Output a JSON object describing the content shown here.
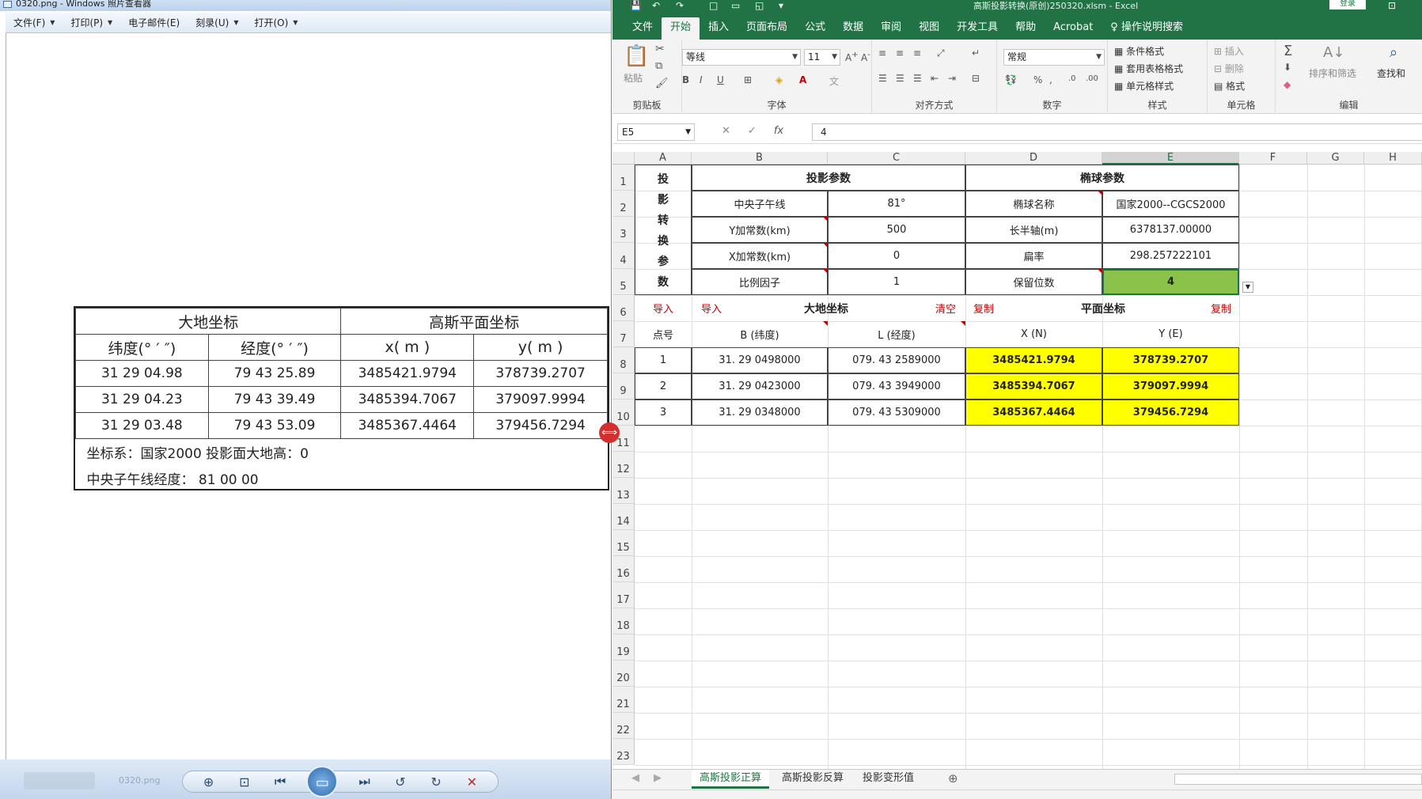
{
  "viewer": {
    "title": "0320.png - Windows 照片查看器",
    "menu": [
      "文件(F)",
      "打印(P)",
      "电子邮件(E)",
      "刻录(U)",
      "打开(O)"
    ],
    "photo_table": {
      "group_headers": [
        "大地坐标",
        "高斯平面坐标"
      ],
      "col_headers": [
        "纬度(° ′ ″)",
        "经度(° ′ ″)",
        "x( m )",
        "y( m )"
      ],
      "rows": [
        [
          "31 29 04.98",
          "79 43 25.89",
          "3485421.9794",
          "378739.2707"
        ],
        [
          "31 29 04.23",
          "79 43 39.49",
          "3485394.7067",
          "379097.9994"
        ],
        [
          "31 29 03.48",
          "79 43 53.09",
          "3485367.4464",
          "379456.7294"
        ]
      ],
      "note1": "坐标系：国家2000    投影面大地高：0",
      "note2": "中央子午线经度：  81 00 00"
    },
    "bottom_label": "0320.png"
  },
  "excel": {
    "title": "高斯投影转换(原创)250320.xlsm  -  Excel",
    "login_label": "登录",
    "ribbon_tabs": [
      "文件",
      "开始",
      "插入",
      "页面布局",
      "公式",
      "数据",
      "审阅",
      "视图",
      "开发工具",
      "帮助",
      "Acrobat"
    ],
    "tell_me": "操作说明搜索",
    "ribbon": {
      "clipboard": {
        "paste": "粘贴",
        "label": "剪贴板"
      },
      "font": {
        "name": "等线",
        "size": "11",
        "label": "字体"
      },
      "align": {
        "label": "对齐方式"
      },
      "number": {
        "format": "常规",
        "label": "数字"
      },
      "styles": {
        "cond": "条件格式",
        "table": "套用表格格式",
        "cell": "单元格样式",
        "label": "样式"
      },
      "cells": {
        "insert": "插入",
        "delete": "删除",
        "format": "格式",
        "label": "单元格"
      },
      "edit": {
        "sort": "排序和筛选",
        "find": "查找和",
        "label": "编辑"
      }
    },
    "name_box": "E5",
    "formula": "4",
    "columns": [
      "A",
      "B",
      "C",
      "D",
      "E",
      "F",
      "G",
      "H"
    ],
    "rows": [
      "1",
      "2",
      "3",
      "4",
      "5",
      "6",
      "7",
      "8",
      "9",
      "10",
      "11",
      "12",
      "13",
      "14",
      "15",
      "16",
      "17",
      "18",
      "19",
      "20",
      "21",
      "22",
      "23"
    ],
    "sheet": {
      "a_vertical": [
        "投",
        "影",
        "转",
        "换",
        "参",
        "数"
      ],
      "proj_header": "投影参数",
      "ellip_header": "椭球参数",
      "params": [
        {
          "k": "中央子午线",
          "v": "81°",
          "k2": "椭球名称",
          "v2": "国家2000--CGCS2000"
        },
        {
          "k": "Y加常数(km)",
          "v": "500",
          "k2": "长半轴(m)",
          "v2": "6378137.00000"
        },
        {
          "k": "X加常数(km)",
          "v": "0",
          "k2": "扁率",
          "v2": "298.257222101"
        },
        {
          "k": "比例因子",
          "v": "1",
          "k2": "保留位数",
          "v2": "4"
        }
      ],
      "row6": {
        "a": "导入",
        "b": "导入",
        "geo": "大地坐标",
        "clear": "清空",
        "copy1": "复制",
        "plane": "平面坐标",
        "copy2": "复制"
      },
      "row7": [
        "点号",
        "B (纬度)",
        "L (经度)",
        "X (N)",
        "Y (E)"
      ],
      "data": [
        [
          "1",
          "31. 29 0498000",
          "079. 43 2589000",
          "3485421.9794",
          "378739.2707"
        ],
        [
          "2",
          "31. 29 0423000",
          "079. 43 3949000",
          "3485394.7067",
          "379097.9994"
        ],
        [
          "3",
          "31. 29 0348000",
          "079. 43 5309000",
          "3485367.4464",
          "379456.7294"
        ]
      ]
    },
    "sheet_tabs": [
      "高斯投影正算",
      "高斯投影反算",
      "投影变形值"
    ]
  }
}
